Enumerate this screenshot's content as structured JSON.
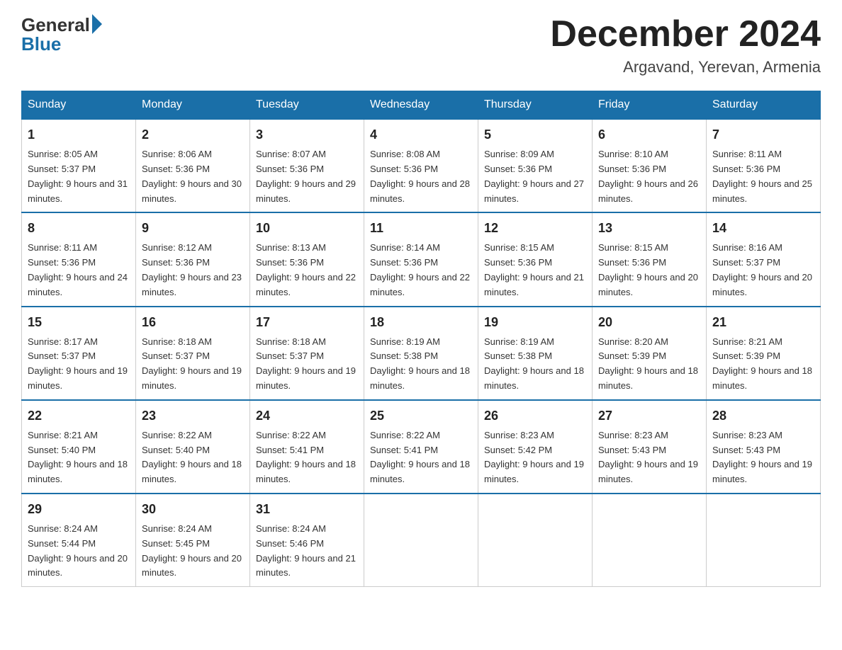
{
  "header": {
    "logo_general": "General",
    "logo_blue": "Blue",
    "month_title": "December 2024",
    "location": "Argavand, Yerevan, Armenia"
  },
  "days_of_week": [
    "Sunday",
    "Monday",
    "Tuesday",
    "Wednesday",
    "Thursday",
    "Friday",
    "Saturday"
  ],
  "weeks": [
    [
      {
        "day": "1",
        "sunrise": "Sunrise: 8:05 AM",
        "sunset": "Sunset: 5:37 PM",
        "daylight": "Daylight: 9 hours and 31 minutes."
      },
      {
        "day": "2",
        "sunrise": "Sunrise: 8:06 AM",
        "sunset": "Sunset: 5:36 PM",
        "daylight": "Daylight: 9 hours and 30 minutes."
      },
      {
        "day": "3",
        "sunrise": "Sunrise: 8:07 AM",
        "sunset": "Sunset: 5:36 PM",
        "daylight": "Daylight: 9 hours and 29 minutes."
      },
      {
        "day": "4",
        "sunrise": "Sunrise: 8:08 AM",
        "sunset": "Sunset: 5:36 PM",
        "daylight": "Daylight: 9 hours and 28 minutes."
      },
      {
        "day": "5",
        "sunrise": "Sunrise: 8:09 AM",
        "sunset": "Sunset: 5:36 PM",
        "daylight": "Daylight: 9 hours and 27 minutes."
      },
      {
        "day": "6",
        "sunrise": "Sunrise: 8:10 AM",
        "sunset": "Sunset: 5:36 PM",
        "daylight": "Daylight: 9 hours and 26 minutes."
      },
      {
        "day": "7",
        "sunrise": "Sunrise: 8:11 AM",
        "sunset": "Sunset: 5:36 PM",
        "daylight": "Daylight: 9 hours and 25 minutes."
      }
    ],
    [
      {
        "day": "8",
        "sunrise": "Sunrise: 8:11 AM",
        "sunset": "Sunset: 5:36 PM",
        "daylight": "Daylight: 9 hours and 24 minutes."
      },
      {
        "day": "9",
        "sunrise": "Sunrise: 8:12 AM",
        "sunset": "Sunset: 5:36 PM",
        "daylight": "Daylight: 9 hours and 23 minutes."
      },
      {
        "day": "10",
        "sunrise": "Sunrise: 8:13 AM",
        "sunset": "Sunset: 5:36 PM",
        "daylight": "Daylight: 9 hours and 22 minutes."
      },
      {
        "day": "11",
        "sunrise": "Sunrise: 8:14 AM",
        "sunset": "Sunset: 5:36 PM",
        "daylight": "Daylight: 9 hours and 22 minutes."
      },
      {
        "day": "12",
        "sunrise": "Sunrise: 8:15 AM",
        "sunset": "Sunset: 5:36 PM",
        "daylight": "Daylight: 9 hours and 21 minutes."
      },
      {
        "day": "13",
        "sunrise": "Sunrise: 8:15 AM",
        "sunset": "Sunset: 5:36 PM",
        "daylight": "Daylight: 9 hours and 20 minutes."
      },
      {
        "day": "14",
        "sunrise": "Sunrise: 8:16 AM",
        "sunset": "Sunset: 5:37 PM",
        "daylight": "Daylight: 9 hours and 20 minutes."
      }
    ],
    [
      {
        "day": "15",
        "sunrise": "Sunrise: 8:17 AM",
        "sunset": "Sunset: 5:37 PM",
        "daylight": "Daylight: 9 hours and 19 minutes."
      },
      {
        "day": "16",
        "sunrise": "Sunrise: 8:18 AM",
        "sunset": "Sunset: 5:37 PM",
        "daylight": "Daylight: 9 hours and 19 minutes."
      },
      {
        "day": "17",
        "sunrise": "Sunrise: 8:18 AM",
        "sunset": "Sunset: 5:37 PM",
        "daylight": "Daylight: 9 hours and 19 minutes."
      },
      {
        "day": "18",
        "sunrise": "Sunrise: 8:19 AM",
        "sunset": "Sunset: 5:38 PM",
        "daylight": "Daylight: 9 hours and 18 minutes."
      },
      {
        "day": "19",
        "sunrise": "Sunrise: 8:19 AM",
        "sunset": "Sunset: 5:38 PM",
        "daylight": "Daylight: 9 hours and 18 minutes."
      },
      {
        "day": "20",
        "sunrise": "Sunrise: 8:20 AM",
        "sunset": "Sunset: 5:39 PM",
        "daylight": "Daylight: 9 hours and 18 minutes."
      },
      {
        "day": "21",
        "sunrise": "Sunrise: 8:21 AM",
        "sunset": "Sunset: 5:39 PM",
        "daylight": "Daylight: 9 hours and 18 minutes."
      }
    ],
    [
      {
        "day": "22",
        "sunrise": "Sunrise: 8:21 AM",
        "sunset": "Sunset: 5:40 PM",
        "daylight": "Daylight: 9 hours and 18 minutes."
      },
      {
        "day": "23",
        "sunrise": "Sunrise: 8:22 AM",
        "sunset": "Sunset: 5:40 PM",
        "daylight": "Daylight: 9 hours and 18 minutes."
      },
      {
        "day": "24",
        "sunrise": "Sunrise: 8:22 AM",
        "sunset": "Sunset: 5:41 PM",
        "daylight": "Daylight: 9 hours and 18 minutes."
      },
      {
        "day": "25",
        "sunrise": "Sunrise: 8:22 AM",
        "sunset": "Sunset: 5:41 PM",
        "daylight": "Daylight: 9 hours and 18 minutes."
      },
      {
        "day": "26",
        "sunrise": "Sunrise: 8:23 AM",
        "sunset": "Sunset: 5:42 PM",
        "daylight": "Daylight: 9 hours and 19 minutes."
      },
      {
        "day": "27",
        "sunrise": "Sunrise: 8:23 AM",
        "sunset": "Sunset: 5:43 PM",
        "daylight": "Daylight: 9 hours and 19 minutes."
      },
      {
        "day": "28",
        "sunrise": "Sunrise: 8:23 AM",
        "sunset": "Sunset: 5:43 PM",
        "daylight": "Daylight: 9 hours and 19 minutes."
      }
    ],
    [
      {
        "day": "29",
        "sunrise": "Sunrise: 8:24 AM",
        "sunset": "Sunset: 5:44 PM",
        "daylight": "Daylight: 9 hours and 20 minutes."
      },
      {
        "day": "30",
        "sunrise": "Sunrise: 8:24 AM",
        "sunset": "Sunset: 5:45 PM",
        "daylight": "Daylight: 9 hours and 20 minutes."
      },
      {
        "day": "31",
        "sunrise": "Sunrise: 8:24 AM",
        "sunset": "Sunset: 5:46 PM",
        "daylight": "Daylight: 9 hours and 21 minutes."
      },
      null,
      null,
      null,
      null
    ]
  ]
}
